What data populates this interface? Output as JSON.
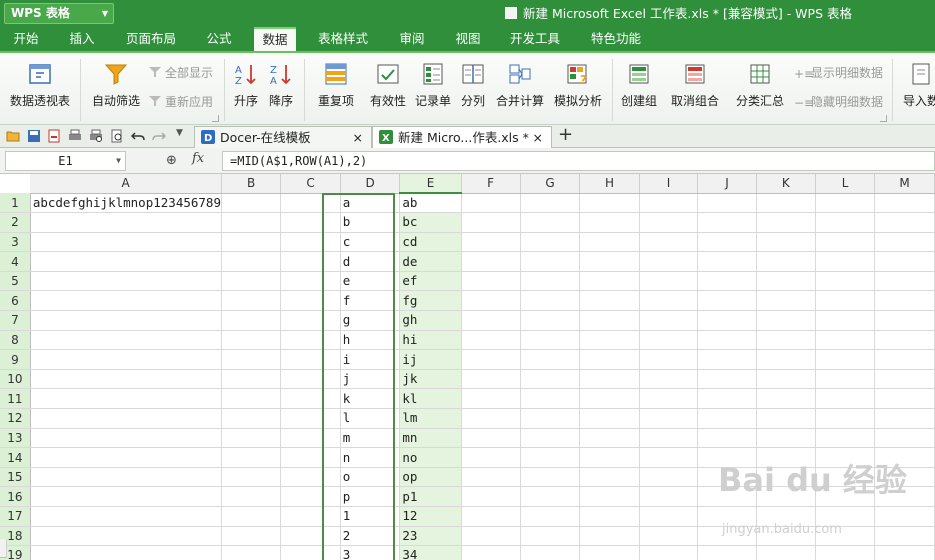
{
  "app": {
    "menu_label": "WPS 表格",
    "doc_title": "新建 Microsoft Excel 工作表.xls * [兼容模式] - WPS 表格"
  },
  "menu": [
    "开始",
    "插入",
    "页面布局",
    "公式",
    "数据",
    "表格样式",
    "审阅",
    "视图",
    "开发工具",
    "特色功能"
  ],
  "active_menu": "数据",
  "ribbon": {
    "pivot": "数据透视表",
    "autofilter": "自动筛选",
    "show_all": "全部显示",
    "reapply": "重新应用",
    "sort_asc": "升序",
    "sort_desc": "降序",
    "duplicates": "重复项",
    "validity": "有效性",
    "record_form": "记录单",
    "split_col": "分列",
    "consolidate": "合并计算",
    "simulate": "模拟分析",
    "group": "创建组",
    "ungroup": "取消组合",
    "subtotal": "分类汇总",
    "show_detail": "显示明细数据",
    "hide_detail": "隐藏明细数据",
    "import": "导入数"
  },
  "tabs": [
    {
      "label": "Docer-在线模板",
      "close": "×"
    },
    {
      "label": "新建 Micro...作表.xls *",
      "close": "×"
    }
  ],
  "add_tab": "+",
  "formula_bar": {
    "name_box": "E1",
    "fx": "fx",
    "formula": "=MID(A$1,ROW(A1),2)"
  },
  "sheet": {
    "columns": [
      "A",
      "B",
      "C",
      "D",
      "E",
      "F",
      "G",
      "H",
      "I",
      "J",
      "K",
      "L",
      "M"
    ],
    "selected_column": "E",
    "active_cell": "E1",
    "rows": [
      {
        "n": "1",
        "A": "abcdefghijklmnop123456789",
        "D": "a",
        "E": "ab"
      },
      {
        "n": "2",
        "D": "b",
        "E": "bc"
      },
      {
        "n": "3",
        "D": "c",
        "E": "cd"
      },
      {
        "n": "4",
        "D": "d",
        "E": "de"
      },
      {
        "n": "5",
        "D": "e",
        "E": "ef"
      },
      {
        "n": "6",
        "D": "f",
        "E": "fg"
      },
      {
        "n": "7",
        "D": "g",
        "E": "gh"
      },
      {
        "n": "8",
        "D": "h",
        "E": "hi"
      },
      {
        "n": "9",
        "D": "i",
        "E": "ij"
      },
      {
        "n": "10",
        "D": "j",
        "E": "jk"
      },
      {
        "n": "11",
        "D": "k",
        "E": "kl"
      },
      {
        "n": "12",
        "D": "l",
        "E": "lm"
      },
      {
        "n": "13",
        "D": "m",
        "E": "mn"
      },
      {
        "n": "14",
        "D": "n",
        "E": "no"
      },
      {
        "n": "15",
        "D": "o",
        "E": "op"
      },
      {
        "n": "16",
        "D": "p",
        "E": "p1"
      },
      {
        "n": "17",
        "D": "1",
        "E": "12"
      },
      {
        "n": "18",
        "D": "2",
        "E": "23"
      },
      {
        "n": "19",
        "D": "3",
        "E": "34"
      }
    ]
  },
  "watermark": {
    "text": "Bai du 经验",
    "url": "jingyan.baidu.com"
  },
  "colors": {
    "accent": "#2f8f3b",
    "selection_fill": "#e4f4df",
    "selection_border": "#4e8b49"
  }
}
